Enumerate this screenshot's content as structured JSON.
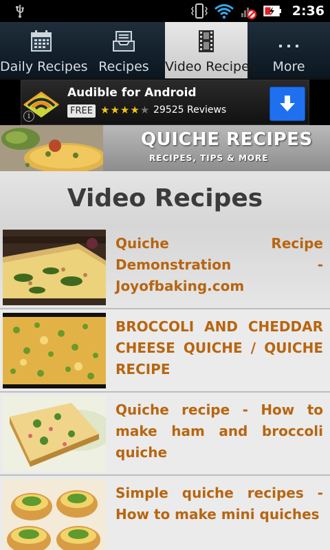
{
  "status_bar": {
    "time": "2:36",
    "icons": [
      "usb-icon",
      "vibrate-icon",
      "wifi-icon",
      "no-signal-icon",
      "battery-charging-icon"
    ]
  },
  "tabs": [
    {
      "label": "Daily Recipes",
      "icon": "calendar-icon",
      "active": false
    },
    {
      "label": "Recipes",
      "icon": "inbox-tray-icon",
      "active": false
    },
    {
      "label": "Video Recipes",
      "icon": "film-strip-icon",
      "active": true
    },
    {
      "label": "More",
      "icon": "more-dots-icon",
      "active": false
    }
  ],
  "ad": {
    "title": "Audible for Android",
    "free_badge": "FREE",
    "rating_stars": 4,
    "reviews": "29525 Reviews",
    "info": "i",
    "colors": {
      "download_button": "#1f70ef",
      "stars": "#f3c316"
    }
  },
  "header_banner": {
    "title": "QUICHE RECIPES",
    "subtitle": "RECIPES, TIPS & MORE"
  },
  "section": {
    "title": "Video Recipes"
  },
  "videos": [
    {
      "title": "Quiche Recipe Demonstration - Joyofbaking.com"
    },
    {
      "title": "BROCCOLI AND CHEDDAR CHEESE QUICHE / QUICHE RECIPE"
    },
    {
      "title": "Quiche recipe - How to make ham and broccoli quiche"
    },
    {
      "title": "Simple quiche recipes - How to make mini quiches"
    }
  ],
  "colors": {
    "video_title": "#b8650f",
    "section_title": "#3b3b3b",
    "tabbar_bg": "#1e2e3a",
    "active_tab_bg": "#d8d8d8"
  }
}
